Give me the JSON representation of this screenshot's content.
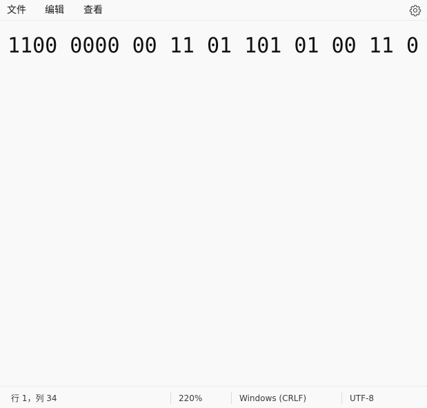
{
  "menu": {
    "file": "文件",
    "edit": "编辑",
    "view": "查看"
  },
  "toolbar": {
    "settings_icon": "gear-icon"
  },
  "editor": {
    "content": "1100 0000 00 11 01 101 01 00 11 0"
  },
  "status": {
    "position": "行 1，列 34",
    "zoom": "220%",
    "line_ending": "Windows (CRLF)",
    "encoding": "UTF-8"
  }
}
